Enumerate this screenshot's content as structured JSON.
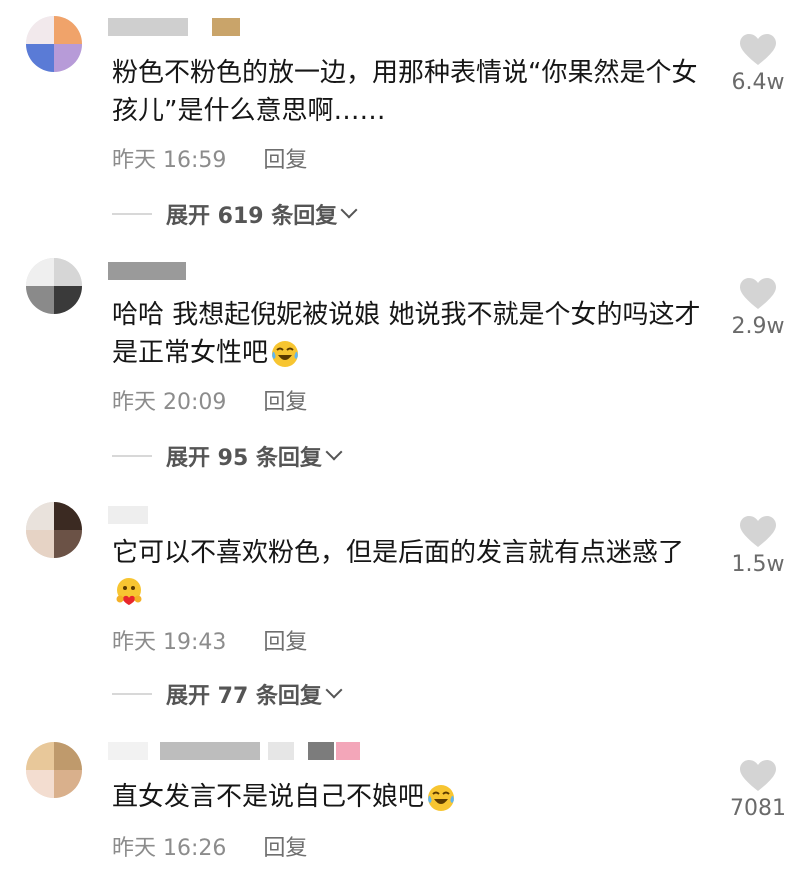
{
  "comments": [
    {
      "text": "粉色不粉色的放一边，用那种表情说“你果然是个女孩儿”是什么意思啊……",
      "time": "昨天 16:59",
      "reply_label": "回复",
      "expand_label": "展开 619 条回复",
      "likes": "6.4w"
    },
    {
      "text": "哈哈  我想起倪妮被说娘  她说我不就是个女的吗这才是正常女性吧",
      "emoji": "laughing-tears-emoji",
      "time": "昨天 20:09",
      "reply_label": "回复",
      "expand_label": "展开 95 条回复",
      "likes": "2.9w"
    },
    {
      "text": "它可以不喜欢粉色，但是后面的发言就有点迷惑了",
      "emoji": "hug-heart-emoji",
      "time": "昨天 19:43",
      "reply_label": "回复",
      "expand_label": "展开 77 条回复",
      "likes": "1.5w"
    },
    {
      "text": "直女发言不是说自己不娘吧",
      "emoji": "laughing-tears-emoji",
      "time": "昨天 16:26",
      "reply_label": "回复",
      "likes": "7081"
    }
  ],
  "colors": {
    "text": "#161616",
    "meta": "#8c8c8c",
    "heart": "#d4d4d4"
  }
}
